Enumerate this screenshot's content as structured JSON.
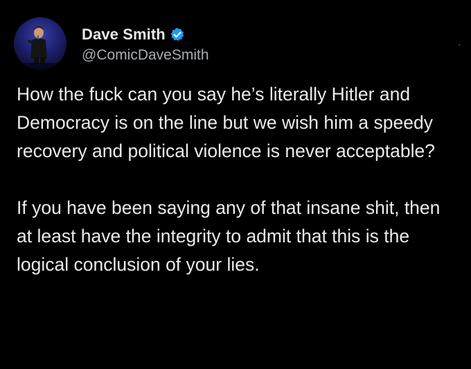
{
  "author": {
    "display_name": "Dave Smith",
    "handle": "@ComicDaveSmith",
    "verified": true,
    "avatar_icon": "comedian-on-stage-avatar",
    "verified_icon": "verified-badge-icon"
  },
  "tweet": {
    "paragraphs": [
      "How the fuck can you say he’s literally Hitler and Democracy is on the line but we wish him a speedy recovery and political violence is never acceptable?",
      "If you have been saying any of that insane shit, then at least have the integrity to admit that this is the logical conclusion of your lies."
    ]
  },
  "colors": {
    "background": "#000000",
    "text": "#e7e9ea",
    "handle": "#a9adb1",
    "verified_badge": "#1d9bf0"
  }
}
